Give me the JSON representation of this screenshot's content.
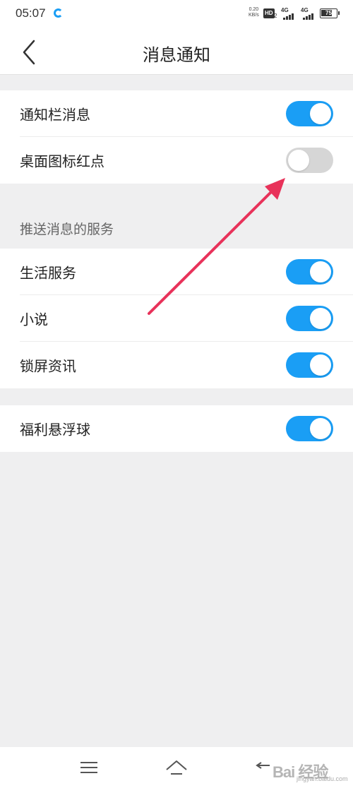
{
  "status_bar": {
    "time": "05:07",
    "net_speed_value": "0.20",
    "net_speed_unit": "KB/s",
    "hd_label": "HD",
    "hd_sub": "2",
    "sim1_label": "4G",
    "sim2_label": "4G",
    "battery_level": "75"
  },
  "header": {
    "title": "消息通知"
  },
  "notifications": [
    {
      "label": "通知栏消息",
      "enabled": true
    },
    {
      "label": "桌面图标红点",
      "enabled": false
    }
  ],
  "push_services": {
    "header": "推送消息的服务",
    "items": [
      {
        "label": "生活服务",
        "enabled": true
      },
      {
        "label": "小说",
        "enabled": true
      },
      {
        "label": "锁屏资讯",
        "enabled": true
      }
    ]
  },
  "extras": [
    {
      "label": "福利悬浮球",
      "enabled": true
    }
  ],
  "colors": {
    "toggle_on": "#1a9ef5",
    "toggle_off": "#d6d6d6",
    "annotation_arrow": "#e8325a"
  },
  "watermark": {
    "text": "Bai 经验",
    "sub": "jingyan.baidu.com"
  }
}
